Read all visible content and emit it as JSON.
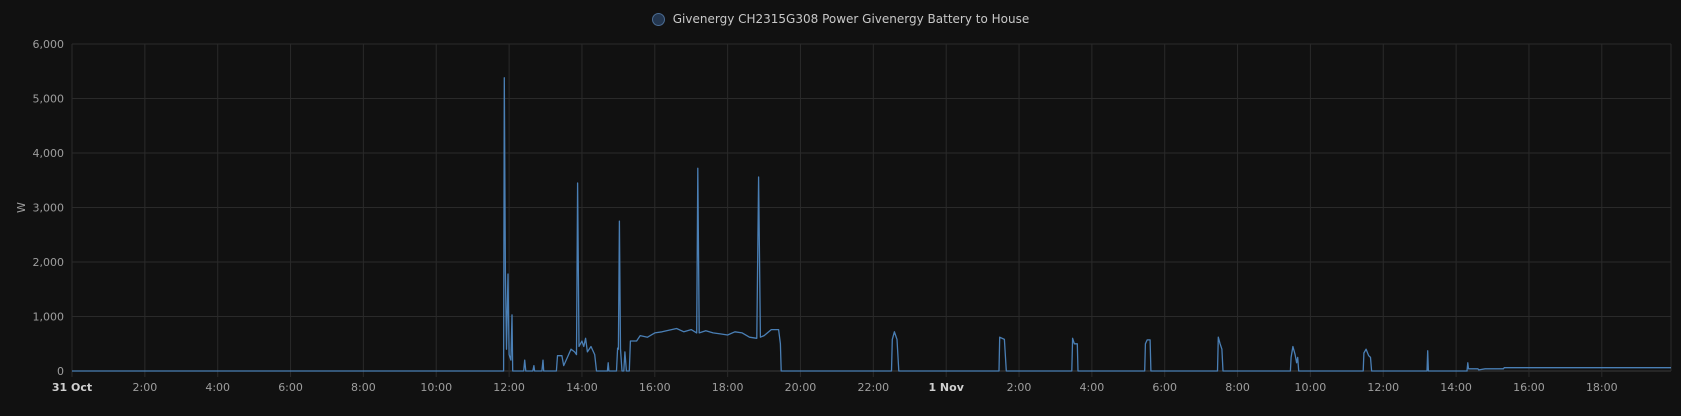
{
  "chart_data": {
    "type": "line",
    "series": [
      {
        "name": "Givenergy CH2315G308 Power Givenergy Battery to House",
        "color": "#4a7fb5",
        "points": [
          [
            0,
            0
          ],
          [
            11.85,
            0
          ],
          [
            11.87,
            5380
          ],
          [
            11.9,
            1800
          ],
          [
            11.93,
            400
          ],
          [
            11.97,
            1780
          ],
          [
            12.0,
            300
          ],
          [
            12.05,
            200
          ],
          [
            12.08,
            1030
          ],
          [
            12.1,
            0
          ],
          [
            12.4,
            0
          ],
          [
            12.43,
            200
          ],
          [
            12.46,
            0
          ],
          [
            12.65,
            0
          ],
          [
            12.68,
            100
          ],
          [
            12.7,
            0
          ],
          [
            12.9,
            0
          ],
          [
            12.93,
            200
          ],
          [
            12.95,
            0
          ],
          [
            13.3,
            0
          ],
          [
            13.33,
            280
          ],
          [
            13.45,
            280
          ],
          [
            13.5,
            100
          ],
          [
            13.6,
            250
          ],
          [
            13.7,
            400
          ],
          [
            13.8,
            350
          ],
          [
            13.85,
            300
          ],
          [
            13.88,
            3450
          ],
          [
            13.92,
            450
          ],
          [
            14.0,
            550
          ],
          [
            14.05,
            450
          ],
          [
            14.1,
            600
          ],
          [
            14.15,
            350
          ],
          [
            14.25,
            450
          ],
          [
            14.35,
            300
          ],
          [
            14.4,
            0
          ],
          [
            14.7,
            0
          ],
          [
            14.72,
            150
          ],
          [
            14.74,
            0
          ],
          [
            14.95,
            0
          ],
          [
            14.98,
            420
          ],
          [
            15.0,
            400
          ],
          [
            15.03,
            2750
          ],
          [
            15.06,
            400
          ],
          [
            15.1,
            0
          ],
          [
            15.15,
            0
          ],
          [
            15.18,
            350
          ],
          [
            15.22,
            0
          ],
          [
            15.3,
            0
          ],
          [
            15.33,
            550
          ],
          [
            15.5,
            550
          ],
          [
            15.6,
            650
          ],
          [
            15.8,
            620
          ],
          [
            16.0,
            700
          ],
          [
            16.2,
            720
          ],
          [
            16.4,
            750
          ],
          [
            16.6,
            780
          ],
          [
            16.8,
            720
          ],
          [
            17.0,
            760
          ],
          [
            17.15,
            700
          ],
          [
            17.18,
            3720
          ],
          [
            17.22,
            700
          ],
          [
            17.4,
            740
          ],
          [
            17.6,
            700
          ],
          [
            17.8,
            680
          ],
          [
            18.0,
            660
          ],
          [
            18.2,
            720
          ],
          [
            18.4,
            700
          ],
          [
            18.6,
            620
          ],
          [
            18.8,
            600
          ],
          [
            18.85,
            3560
          ],
          [
            18.9,
            620
          ],
          [
            19.0,
            650
          ],
          [
            19.2,
            760
          ],
          [
            19.4,
            760
          ],
          [
            19.45,
            500
          ],
          [
            19.47,
            0
          ],
          [
            22.5,
            0
          ],
          [
            22.52,
            580
          ],
          [
            22.58,
            720
          ],
          [
            22.65,
            580
          ],
          [
            22.7,
            0
          ],
          [
            25.45,
            0
          ],
          [
            25.47,
            620
          ],
          [
            25.6,
            580
          ],
          [
            25.65,
            0
          ],
          [
            27.45,
            0
          ],
          [
            27.47,
            600
          ],
          [
            27.52,
            500
          ],
          [
            27.6,
            500
          ],
          [
            27.62,
            0
          ],
          [
            29.45,
            0
          ],
          [
            29.47,
            500
          ],
          [
            29.52,
            570
          ],
          [
            29.6,
            570
          ],
          [
            29.62,
            0
          ],
          [
            31.45,
            0
          ],
          [
            31.47,
            620
          ],
          [
            31.52,
            500
          ],
          [
            31.57,
            400
          ],
          [
            31.6,
            0
          ],
          [
            33.45,
            0
          ],
          [
            33.47,
            250
          ],
          [
            33.52,
            450
          ],
          [
            33.58,
            300
          ],
          [
            33.62,
            150
          ],
          [
            33.65,
            250
          ],
          [
            33.68,
            0
          ],
          [
            35.45,
            0
          ],
          [
            35.47,
            330
          ],
          [
            35.53,
            400
          ],
          [
            35.6,
            280
          ],
          [
            35.65,
            250
          ],
          [
            35.68,
            0
          ],
          [
            37.2,
            0
          ],
          [
            37.22,
            370
          ],
          [
            37.24,
            0
          ],
          [
            38.3,
            0
          ],
          [
            38.32,
            150
          ],
          [
            38.34,
            40
          ],
          [
            38.6,
            40
          ],
          [
            38.62,
            20
          ],
          [
            38.8,
            40
          ],
          [
            39.0,
            40
          ],
          [
            39.2,
            40
          ],
          [
            39.3,
            40
          ],
          [
            39.32,
            60
          ],
          [
            40.0,
            60
          ],
          [
            42.0,
            60
          ],
          [
            43.9,
            60
          ]
        ]
      }
    ],
    "ylabel": "W",
    "ylim": [
      0,
      6000
    ],
    "xlim": [
      0,
      43.9
    ],
    "yticks": [
      {
        "value": 0,
        "label": "0"
      },
      {
        "value": 1000,
        "label": "1,000"
      },
      {
        "value": 2000,
        "label": "2,000"
      },
      {
        "value": 3000,
        "label": "3,000"
      },
      {
        "value": 4000,
        "label": "4,000"
      },
      {
        "value": 5000,
        "label": "5,000"
      },
      {
        "value": 6000,
        "label": "6,000"
      }
    ],
    "xticks": [
      {
        "value": 0,
        "label": "31 Oct",
        "bold": true
      },
      {
        "value": 2,
        "label": "2:00"
      },
      {
        "value": 4,
        "label": "4:00"
      },
      {
        "value": 6,
        "label": "6:00"
      },
      {
        "value": 8,
        "label": "8:00"
      },
      {
        "value": 10,
        "label": "10:00"
      },
      {
        "value": 12,
        "label": "12:00"
      },
      {
        "value": 14,
        "label": "14:00"
      },
      {
        "value": 16,
        "label": "16:00"
      },
      {
        "value": 18,
        "label": "18:00"
      },
      {
        "value": 20,
        "label": "20:00"
      },
      {
        "value": 22,
        "label": "22:00"
      },
      {
        "value": 24,
        "label": "1 Nov",
        "bold": true
      },
      {
        "value": 26,
        "label": "2:00"
      },
      {
        "value": 28,
        "label": "4:00"
      },
      {
        "value": 30,
        "label": "6:00"
      },
      {
        "value": 32,
        "label": "8:00"
      },
      {
        "value": 34,
        "label": "10:00"
      },
      {
        "value": 36,
        "label": "12:00"
      },
      {
        "value": 38,
        "label": "14:00"
      },
      {
        "value": 40,
        "label": "16:00"
      },
      {
        "value": 42,
        "label": "18:00"
      }
    ],
    "grid": true,
    "legend": "top-center"
  }
}
